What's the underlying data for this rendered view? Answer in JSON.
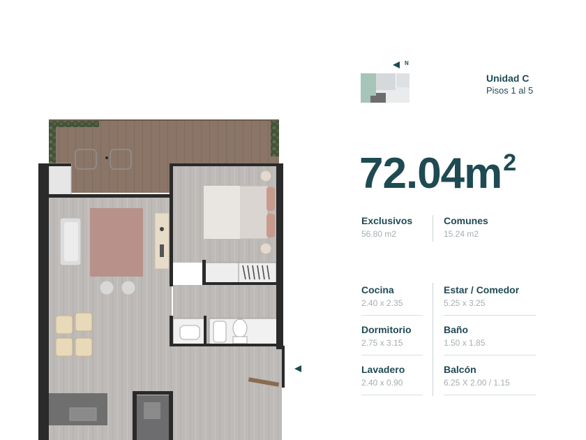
{
  "compass": {
    "letter": "N",
    "icon": "north-arrow-icon"
  },
  "unit": {
    "title": "Unidad C",
    "floors": "Pisos 1 al 5"
  },
  "area": {
    "value": "72.04m",
    "sup": "2"
  },
  "summary": [
    {
      "label": "Exclusivos",
      "value": "56.80 m2"
    },
    {
      "label": "Comunes",
      "value": "15.24 m2"
    }
  ],
  "rooms": [
    {
      "label": "Cocina",
      "value": "2.40 x 2.35"
    },
    {
      "label": "Estar / Comedor",
      "value": "5.25 x 3.25"
    },
    {
      "label": "Dormitorio",
      "value": "2.75 x 3.15"
    },
    {
      "label": "Baño",
      "value": "1.50 x 1.85"
    },
    {
      "label": "Lavadero",
      "value": "2.40 x 0.90"
    },
    {
      "label": "Balcón",
      "value": "6.25 X 2.00 / 1.15"
    }
  ],
  "colors": {
    "accent": "#1e4a52",
    "muted": "#a5aeb0",
    "floor_wood": "#b9b6b3",
    "balcony_deck": "#8b7769",
    "rug": "#b7918a",
    "walls": "#2a2a2a"
  }
}
